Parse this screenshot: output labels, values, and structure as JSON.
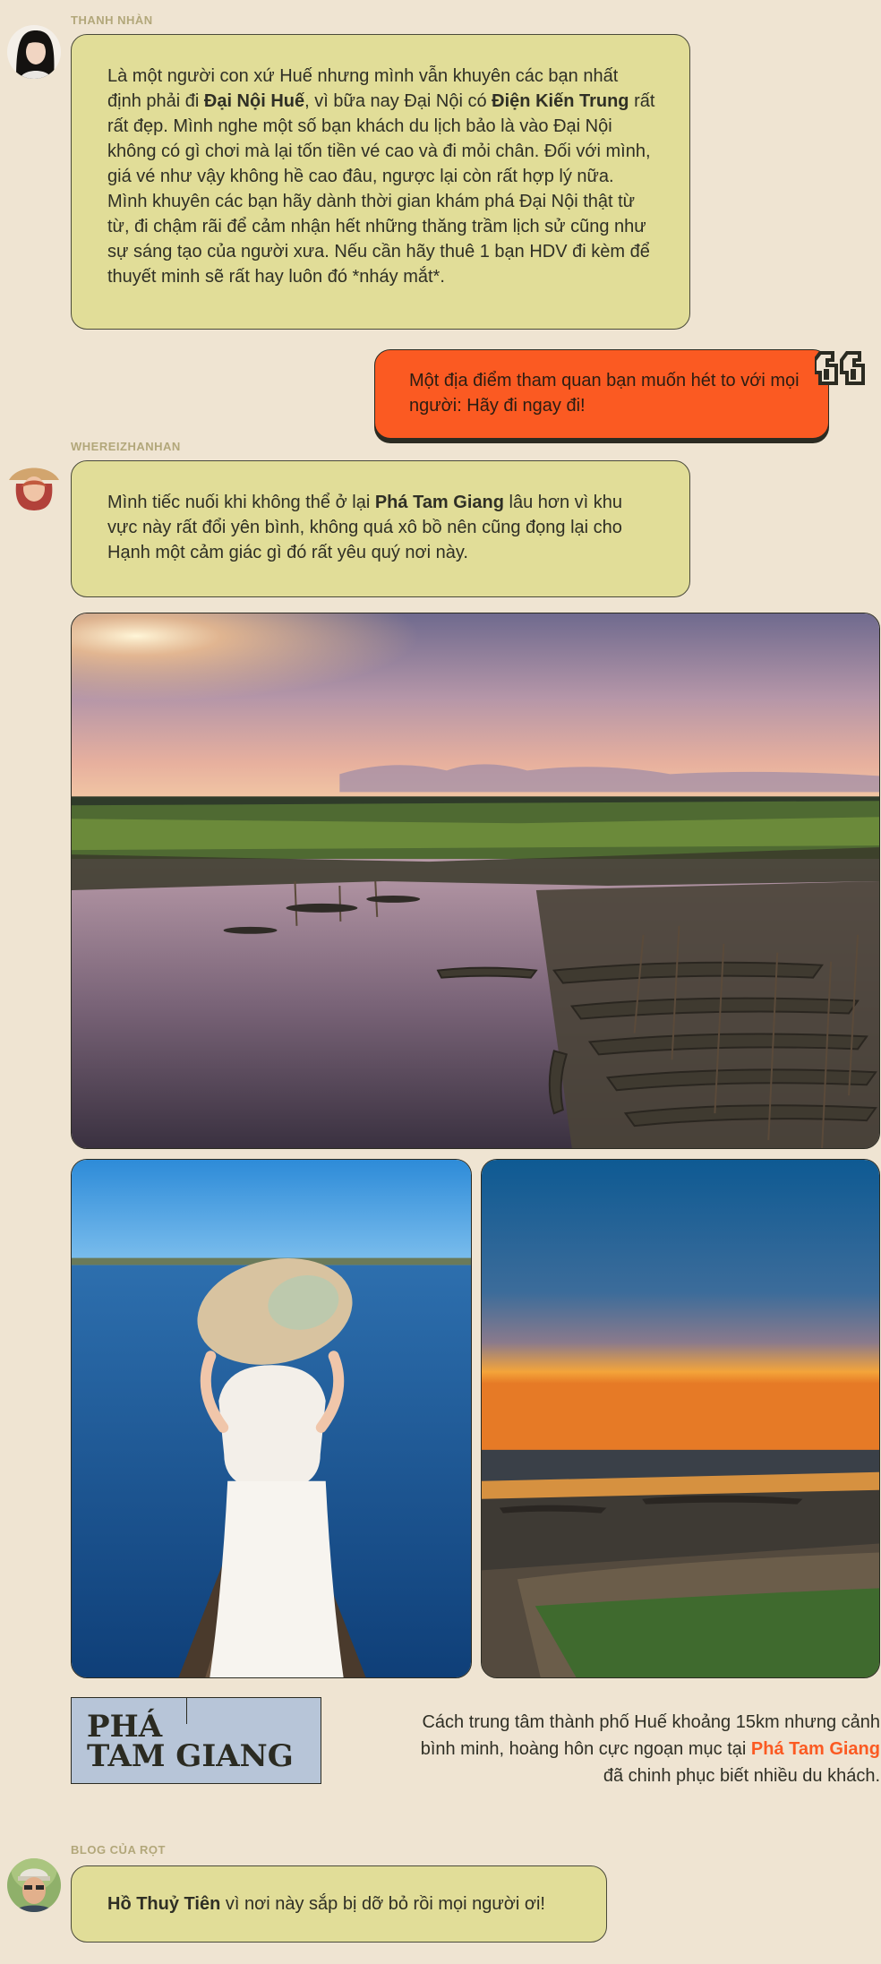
{
  "messages": [
    {
      "username": "THANH NHÀN",
      "text_parts": [
        "Là một người con xứ Huế nhưng mình vẫn khuyên các bạn nhất định phải đi ",
        "Đại Nội Huế",
        ", vì bữa nay Đại Nội có ",
        "Điện Kiến Trung",
        " rất rất đẹp. Mình nghe một số bạn khách du lịch bảo là vào Đại Nội không có gì chơi mà lại tốn tiền vé cao và đi mỏi chân. Đối với mình, giá vé như vậy không hề cao đâu, ngược lại còn rất hợp lý nữa. Mình khuyên các bạn hãy dành thời gian khám phá Đại Nội thật từ từ, đi chậm rãi để cảm nhận hết những thăng trầm lịch sử cũng như sự sáng tạo của người xưa. Nếu cần hãy thuê 1 bạn HDV đi kèm để thuyết minh sẽ rất hay luôn đó *nháy mắt*."
      ]
    },
    {
      "username": "WHEREIZHANHAN",
      "text_parts": [
        "Mình tiếc nuối khi không thể ở lại ",
        "Phá Tam Giang",
        " lâu hơn vì khu vực này rất đổi yên bình, không quá xô bồ nên cũng đọng lại cho Hạnh một cảm giác gì đó rất yêu quý nơi này."
      ]
    },
    {
      "username": "BLOG CỦA RỌT",
      "text_parts": [
        "Hồ Thuỷ Tiên",
        " vì nơi này sắp bị dỡ bỏ rồi mọi người ơi!"
      ]
    }
  ],
  "highlight_bubble": {
    "text": "Một địa điểm tham quan bạn muốn hét to với mọi người: Hãy đi ngay đi!"
  },
  "section": {
    "title_line1": "PHÁ",
    "title_line2": "TAM GIANG",
    "caption_part1": "Cách trung tâm thành phố Huế khoảng 15km nhưng cảnh bình minh, hoàng hôn cực ngoạn mục tại",
    "caption_highlight": "Phá Tam Giang",
    "caption_part2": " đã chinh phục biết nhiều du khách."
  },
  "colors": {
    "background": "#efe4d2",
    "bubble": "#e1dd98",
    "accent": "#fb5a22",
    "title_box": "#b7c5d8",
    "username": "#b2a77a"
  },
  "icons": [
    "quote-icon"
  ]
}
